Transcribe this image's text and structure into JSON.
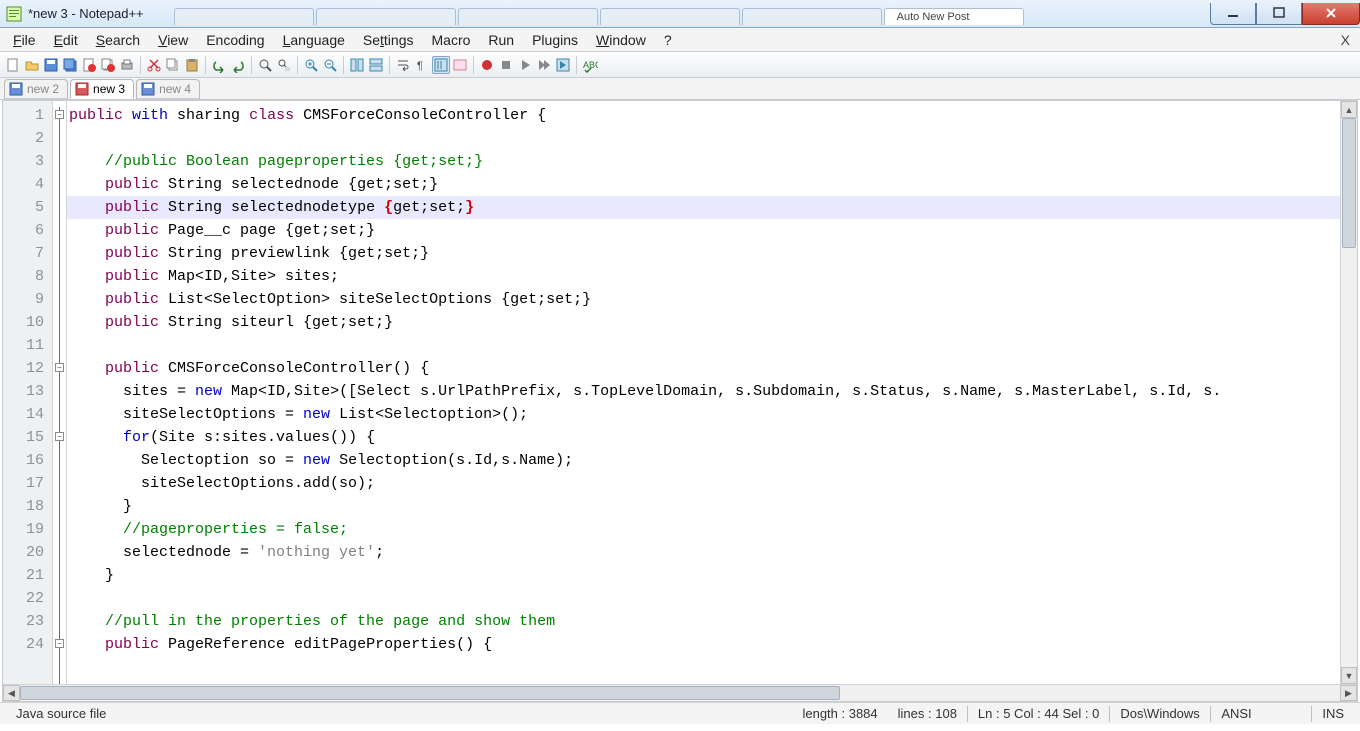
{
  "title": "*new  3 - Notepad++",
  "browser_tabs": [
    "",
    "",
    "",
    "",
    "",
    "Auto New Post"
  ],
  "menu": [
    "File",
    "Edit",
    "Search",
    "View",
    "Encoding",
    "Language",
    "Settings",
    "Macro",
    "Run",
    "Plugins",
    "Window",
    "?"
  ],
  "doc_tabs": [
    {
      "label": "new 2",
      "active": false,
      "dirty": false
    },
    {
      "label": "new 3",
      "active": true,
      "dirty": true
    },
    {
      "label": "new 4",
      "active": false,
      "dirty": false
    }
  ],
  "code": {
    "highlight_line": 5,
    "lines": [
      [
        {
          "t": "public",
          "c": "kw1"
        },
        {
          "t": " "
        },
        {
          "t": "with",
          "c": "kw2"
        },
        {
          "t": " sharing "
        },
        {
          "t": "class",
          "c": "kw1"
        },
        {
          "t": " CMSForceConsoleController {"
        }
      ],
      [],
      [
        {
          "t": "    "
        },
        {
          "t": "//public Boolean pageproperties {get;set;}",
          "c": "cm"
        }
      ],
      [
        {
          "t": "    "
        },
        {
          "t": "public",
          "c": "kw1"
        },
        {
          "t": " String selectednode {get;set;}"
        }
      ],
      [
        {
          "t": "    "
        },
        {
          "t": "public",
          "c": "kw1"
        },
        {
          "t": " String selectednodetype "
        },
        {
          "t": "{",
          "c": "brc"
        },
        {
          "t": "get;set;"
        },
        {
          "t": "}",
          "c": "brc"
        }
      ],
      [
        {
          "t": "    "
        },
        {
          "t": "public",
          "c": "kw1"
        },
        {
          "t": " Page__c page {get;set;}"
        }
      ],
      [
        {
          "t": "    "
        },
        {
          "t": "public",
          "c": "kw1"
        },
        {
          "t": " String previewlink {get;set;}"
        }
      ],
      [
        {
          "t": "    "
        },
        {
          "t": "public",
          "c": "kw1"
        },
        {
          "t": " Map<ID,Site> sites;"
        }
      ],
      [
        {
          "t": "    "
        },
        {
          "t": "public",
          "c": "kw1"
        },
        {
          "t": " List<SelectOption> siteSelectOptions {get;set;}"
        }
      ],
      [
        {
          "t": "    "
        },
        {
          "t": "public",
          "c": "kw1"
        },
        {
          "t": " String siteurl {get;set;}"
        }
      ],
      [],
      [
        {
          "t": "    "
        },
        {
          "t": "public",
          "c": "kw1"
        },
        {
          "t": " CMSForceConsoleController() {"
        }
      ],
      [
        {
          "t": "      sites = "
        },
        {
          "t": "new",
          "c": "kw2"
        },
        {
          "t": " Map<ID,Site>([Select s.UrlPathPrefix, s.TopLevelDomain, s.Subdomain, s.Status, s.Name, s.MasterLabel, s.Id, s."
        }
      ],
      [
        {
          "t": "      siteSelectOptions = "
        },
        {
          "t": "new",
          "c": "kw2"
        },
        {
          "t": " List<Selectoption>();"
        }
      ],
      [
        {
          "t": "      "
        },
        {
          "t": "for",
          "c": "kw2"
        },
        {
          "t": "(Site s:sites.values()) {"
        }
      ],
      [
        {
          "t": "        Selectoption so = "
        },
        {
          "t": "new",
          "c": "kw2"
        },
        {
          "t": " Selectoption(s.Id,s.Name);"
        }
      ],
      [
        {
          "t": "        siteSelectOptions.add(so);"
        }
      ],
      [
        {
          "t": "      }"
        }
      ],
      [
        {
          "t": "      "
        },
        {
          "t": "//pageproperties = false;",
          "c": "cm"
        }
      ],
      [
        {
          "t": "      selectednode = "
        },
        {
          "t": "'nothing yet'",
          "c": "str"
        },
        {
          "t": ";"
        }
      ],
      [
        {
          "t": "    }"
        }
      ],
      [],
      [
        {
          "t": "    "
        },
        {
          "t": "//pull in the properties of the page and show them",
          "c": "cm"
        }
      ],
      [
        {
          "t": "    "
        },
        {
          "t": "public",
          "c": "kw1"
        },
        {
          "t": " PageReference editPageProperties() {"
        }
      ]
    ],
    "fold_markers": [
      1,
      12,
      15,
      24
    ]
  },
  "status": {
    "lang": "Java source file",
    "length": "length : 3884",
    "lines": "lines : 108",
    "pos": "Ln : 5   Col : 44   Sel : 0",
    "eol": "Dos\\Windows",
    "enc": "ANSI",
    "ins": "INS"
  }
}
